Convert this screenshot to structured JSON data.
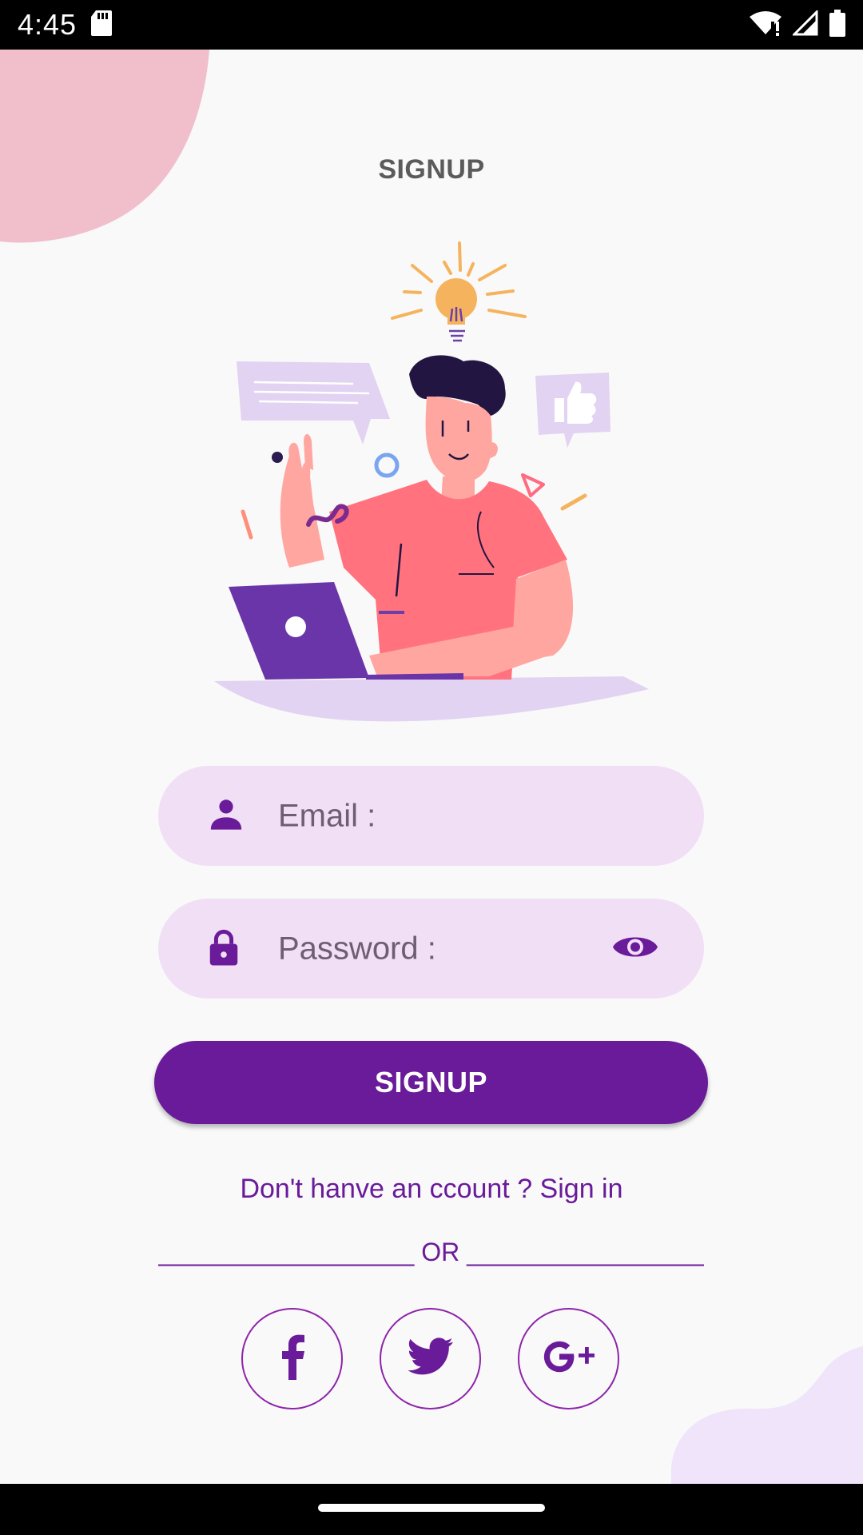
{
  "status_bar": {
    "time": "4:45",
    "icons": [
      "sd-card-icon",
      "wifi-icon",
      "signal-icon",
      "battery-icon"
    ]
  },
  "page": {
    "title": "SIGNUP"
  },
  "form": {
    "email_placeholder": "Email :",
    "email_icon": "person-icon",
    "password_placeholder": "Password :",
    "password_icon": "lock-icon",
    "visibility_icon": "eye-icon",
    "submit_label": "SIGNUP"
  },
  "links": {
    "signin_text": "Don't hanve an ccount ? Sign in"
  },
  "divider": {
    "text": "__________________ OR __________________"
  },
  "social": [
    {
      "name": "facebook",
      "icon": "facebook-icon"
    },
    {
      "name": "twitter",
      "icon": "twitter-icon"
    },
    {
      "name": "google-plus",
      "icon": "google-plus-icon"
    }
  ],
  "colors": {
    "primary": "#6a1b9a",
    "field_bg": "#f1dff5",
    "background": "#f9f9f9",
    "blob_pink": "#f0bfcb",
    "blob_lavender": "#efe4fa"
  }
}
